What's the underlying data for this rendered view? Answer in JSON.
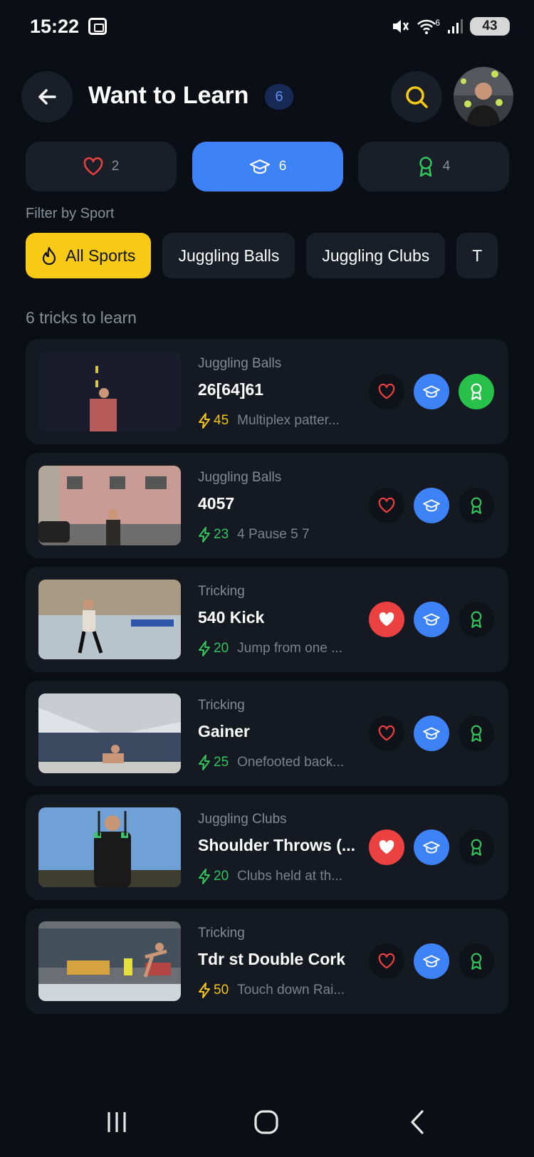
{
  "status": {
    "time": "15:22",
    "wifi_label": "6",
    "battery": "43"
  },
  "header": {
    "title": "Want to Learn",
    "count": "6"
  },
  "tabs": [
    {
      "id": "favorites",
      "icon": "heart-icon",
      "count": "2",
      "active": false
    },
    {
      "id": "learn",
      "icon": "graduation-cap-icon",
      "count": "6",
      "active": true
    },
    {
      "id": "learned",
      "icon": "award-icon",
      "count": "4",
      "active": false
    }
  ],
  "filter": {
    "label": "Filter by Sport",
    "chips": [
      {
        "label": "All Sports",
        "icon": "flame-icon",
        "active": true
      },
      {
        "label": "Juggling Balls",
        "active": false
      },
      {
        "label": "Juggling Clubs",
        "active": false
      },
      {
        "label": "T",
        "active": false
      }
    ]
  },
  "list": {
    "count_label": "6 tricks to learn",
    "items": [
      {
        "sport": "Juggling Balls",
        "title": "26[64]61",
        "points": "45",
        "points_color": "#f5c518",
        "description": "Multiplex patter...",
        "favorite": false,
        "learn": true,
        "learned": true
      },
      {
        "sport": "Juggling Balls",
        "title": "4057",
        "points": "23",
        "points_color": "#31c55e",
        "description": "4 Pause 5 7",
        "favorite": false,
        "learn": true,
        "learned": false
      },
      {
        "sport": "Tricking",
        "title": "540 Kick",
        "points": "20",
        "points_color": "#31c55e",
        "description": "Jump from one ...",
        "favorite": true,
        "learn": true,
        "learned": false
      },
      {
        "sport": "Tricking",
        "title": "Gainer",
        "points": "25",
        "points_color": "#31c55e",
        "description": "Onefooted back...",
        "favorite": false,
        "learn": true,
        "learned": false
      },
      {
        "sport": "Juggling Clubs",
        "title": "Shoulder Throws (...",
        "points": "20",
        "points_color": "#31c55e",
        "description": "Clubs held at th...",
        "favorite": true,
        "learn": true,
        "learned": false
      },
      {
        "sport": "Tricking",
        "title": "Tdr st Double Cork",
        "points": "50",
        "points_color": "#f5c518",
        "description": "Touch down Rai...",
        "favorite": false,
        "learn": true,
        "learned": false
      }
    ]
  },
  "colors": {
    "accent_blue": "#3d82f6",
    "accent_yellow": "#f7cb15",
    "heart_red": "#ec4141",
    "award_green": "#27c04b",
    "background": "#0b0e15",
    "card": "#151922"
  }
}
